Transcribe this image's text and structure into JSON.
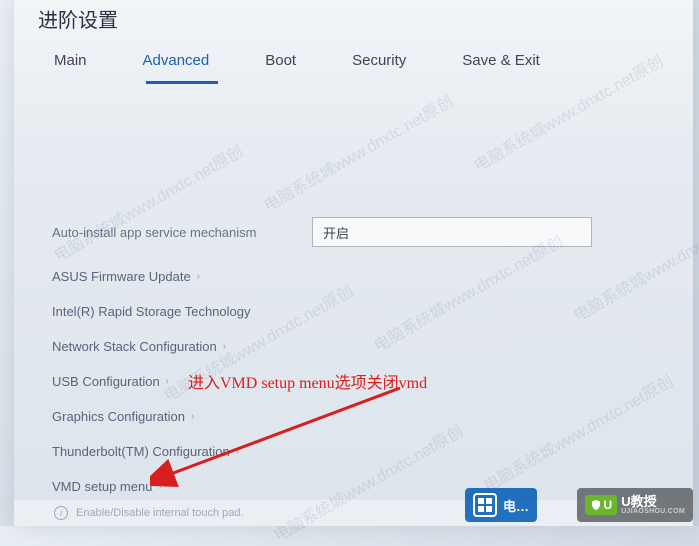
{
  "title": "进阶设置",
  "tabs": {
    "main": "Main",
    "advanced": "Advanced",
    "boot": "Boot",
    "security": "Security",
    "save_exit": "Save & Exit"
  },
  "settings": {
    "auto_service": {
      "label": "Auto-install app service mechanism",
      "value": "开启"
    },
    "asus_fw": "ASUS Firmware Update",
    "intel_rst": "Intel(R) Rapid Storage Technology",
    "net_stack": "Network Stack Configuration",
    "usb": "USB Configuration",
    "graphics": "Graphics Configuration",
    "thunderbolt": "Thunderbolt(TM) Configuration",
    "vmd": "VMD setup menu"
  },
  "hint": "Enable/Disable internal touch pad.",
  "watermark": "电脑系统城www.dnxtc.net原创",
  "annotation": "进入VMD setup menu选项关闭vmd",
  "logos": {
    "l1": "电…",
    "l2_badge": "U",
    "l2_cn": "U教授",
    "l2_en": "UJIAOSHOU.COM"
  }
}
